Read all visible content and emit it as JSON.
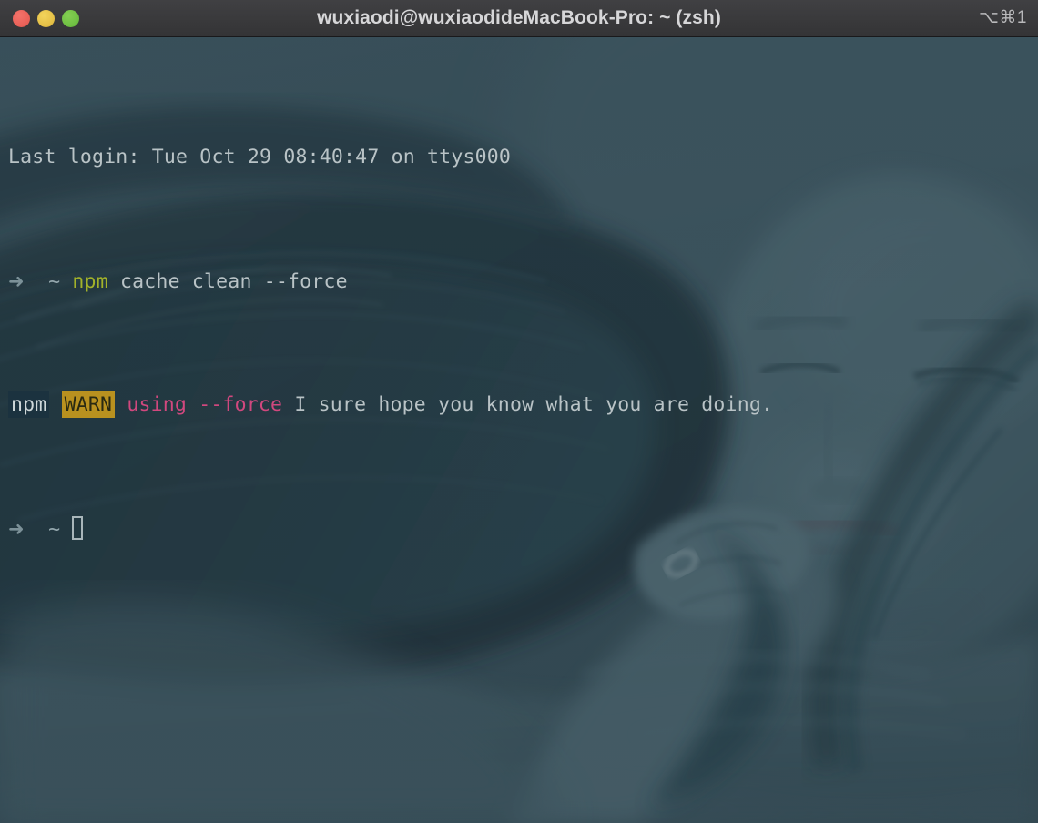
{
  "window": {
    "title": "wuxiaodi@wuxiaodideMacBook-Pro: ~ (zsh)",
    "shortcut_badge": "⌥⌘1",
    "traffic_lights": {
      "close_label": "close",
      "minimize_label": "minimize",
      "maximize_label": "maximize",
      "close_color": "#ea6158",
      "minimize_color": "#e5c046",
      "maximize_color": "#6fc043"
    },
    "titlebar_color": "#3a3a3c",
    "titlebar_text_color": "#d6d6d8"
  },
  "terminal": {
    "background_color": "#33464f",
    "foreground_color": "#b9c3c6",
    "shell": "zsh",
    "lines": [
      {
        "id": "last-login",
        "text": "Last login: Tue Oct 29 08:40:47 on ttys000"
      },
      {
        "id": "command-line",
        "prompt_arrow": "➜",
        "prompt_dir": "~",
        "command_name": "npm",
        "command_args": "cache clean --force",
        "command_name_color": "#a3b22a"
      },
      {
        "id": "npm-warn-line",
        "tag_npm": "npm",
        "tag_warn": "WARN",
        "warn_subject": "using --force",
        "warn_message": "I sure hope you know what you are doing.",
        "tag_npm_bg": "#1b323f",
        "tag_warn_bg": "#b9911f",
        "warn_subject_color": "#d1487e"
      },
      {
        "id": "prompt-line",
        "prompt_arrow": "➜",
        "prompt_dir": "~",
        "cursor": "block"
      }
    ]
  }
}
